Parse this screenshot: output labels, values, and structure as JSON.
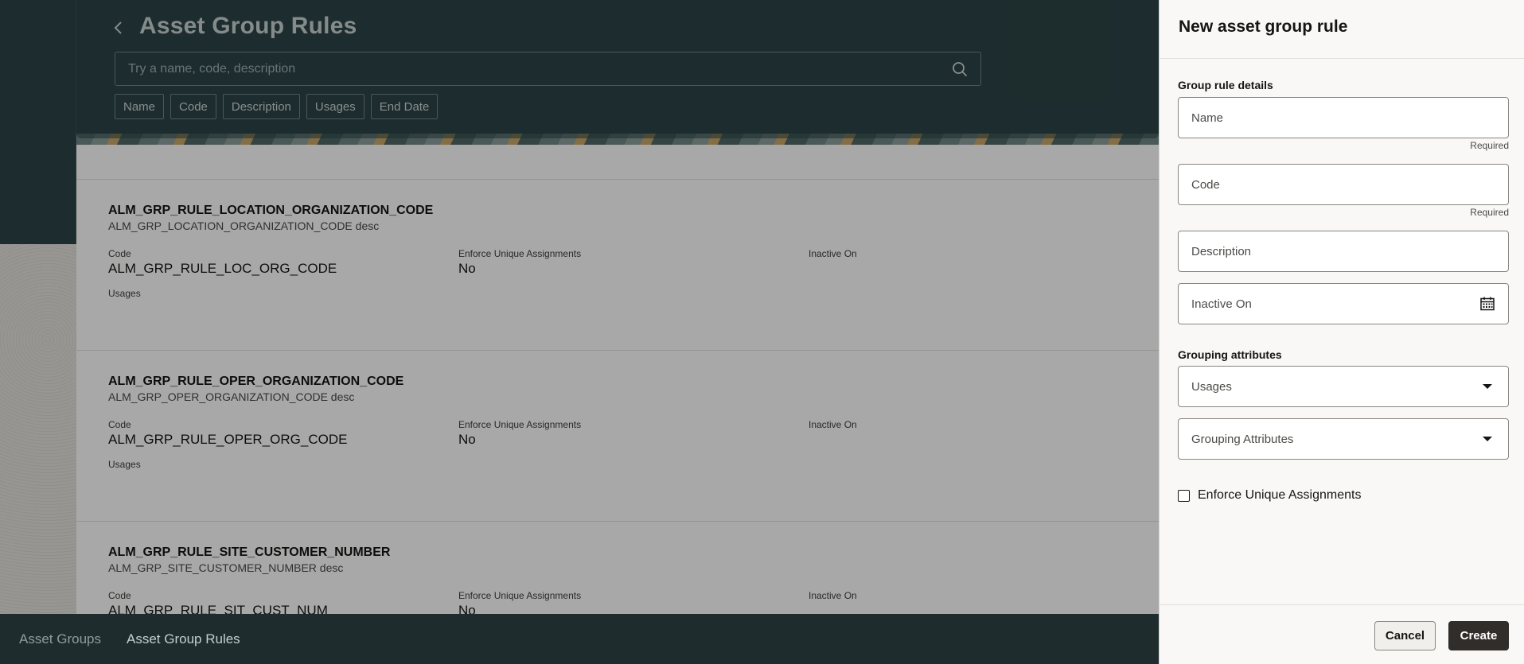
{
  "page": {
    "title": "Asset Group Rules",
    "search_placeholder": "Try a name, code, description",
    "filters": [
      "Name",
      "Code",
      "Description",
      "Usages",
      "End Date"
    ]
  },
  "labels": {
    "code": "Code",
    "enforce": "Enforce Unique Assignments",
    "inactive": "Inactive On",
    "usages": "Usages"
  },
  "rules": [
    {
      "name": "ALM_GRP_RULE_LOCATION_ORGANIZATION_CODE",
      "description": "ALM_GRP_LOCATION_ORGANIZATION_CODE desc",
      "code": "ALM_GRP_RULE_LOC_ORG_CODE",
      "enforce_unique": "No"
    },
    {
      "name": "ALM_GRP_RULE_OPER_ORGANIZATION_CODE",
      "description": "ALM_GRP_OPER_ORGANIZATION_CODE desc",
      "code": "ALM_GRP_RULE_OPER_ORG_CODE",
      "enforce_unique": "No"
    },
    {
      "name": "ALM_GRP_RULE_SITE_CUSTOMER_NUMBER",
      "description": "ALM_GRP_SITE_CUSTOMER_NUMBER desc",
      "code": "ALM_GRP_RULE_SIT_CUST_NUM",
      "enforce_unique": "No"
    }
  ],
  "bottom_nav": {
    "items": [
      "Asset Groups",
      "Asset Group Rules"
    ],
    "active": "Asset Group Rules"
  },
  "drawer": {
    "title": "New asset group rule",
    "section_details": "Group rule details",
    "name_label": "Name",
    "code_label": "Code",
    "required_text": "Required",
    "description_label": "Description",
    "inactive_label": "Inactive On",
    "section_grouping": "Grouping attributes",
    "usages_label": "Usages",
    "grouping_attributes_label": "Grouping Attributes",
    "enforce_label": "Enforce Unique Assignments",
    "cancel_label": "Cancel",
    "create_label": "Create"
  },
  "colors": {
    "header_bg": "#2c4446",
    "nav_bg": "#1f2c2e",
    "drawer_bg": "#f9f8f6",
    "primary_button": "#312d2a"
  },
  "icons": {
    "back": "chevron-left-icon",
    "search": "search-icon",
    "calendar": "calendar-icon",
    "dropdown": "caret-down-icon"
  }
}
